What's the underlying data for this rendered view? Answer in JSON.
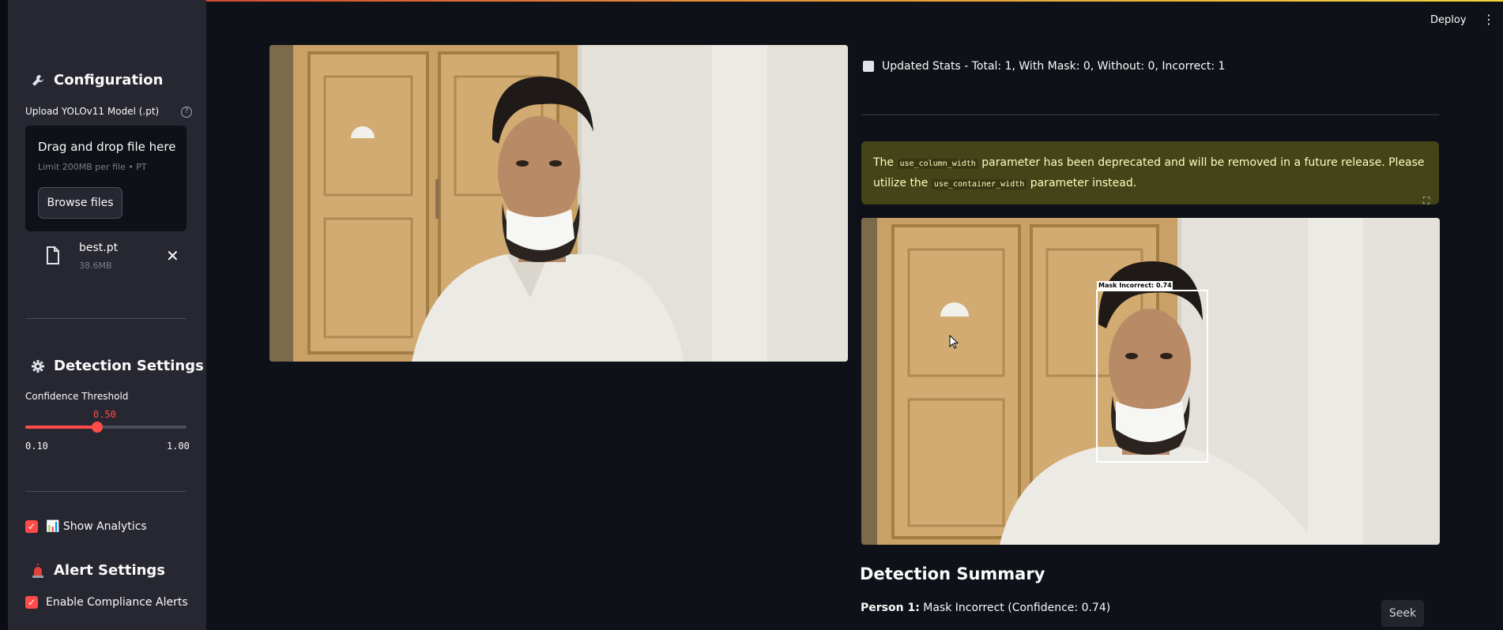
{
  "header": {
    "deploy_label": "Deploy",
    "menu_icon": "kebab-menu-icon"
  },
  "sidebar": {
    "configuration_heading": "Configuration",
    "configuration_icon": "wrench-icon",
    "upload_label": "Upload YOLOv11 Model (.pt)",
    "dropzone_title": "Drag and drop file here",
    "dropzone_subtitle": "Limit 200MB per file • PT",
    "browse_label": "Browse files",
    "uploaded_file": {
      "name": "best.pt",
      "size": "38.6MB"
    },
    "detection_heading": "Detection Settings",
    "detection_icon": "gear-icon",
    "confidence_label": "Confidence Threshold",
    "confidence": {
      "value": "0.50",
      "min": "0.10",
      "max": "1.00",
      "fraction": 0.444
    },
    "show_analytics_label": "📊 Show Analytics",
    "show_analytics_checked": true,
    "alert_heading": "Alert Settings",
    "alert_icon": "siren-icon",
    "enable_alerts_label": "Enable Compliance Alerts",
    "enable_alerts_checked": true
  },
  "main": {
    "stats_text": "Updated Stats - Total: 1, With Mask: 0, Without: 0, Incorrect: 1",
    "warning": {
      "pre": "The",
      "code1": "use_column_width",
      "mid": "parameter has been deprecated and will be removed in a future release. Please utilize the",
      "code2": "use_container_width",
      "post": "parameter instead."
    },
    "detection_box_label": "Mask Incorrect: 0.74",
    "summary_heading": "Detection Summary",
    "person_label": "Person 1:",
    "person_detail": "Mask Incorrect (Confidence: 0.74)",
    "seek_label": "Seek"
  },
  "colors": {
    "accent": "#ff4b4b",
    "background": "#0e1117",
    "sidebar": "#262730",
    "warning_bg": "#444418"
  }
}
